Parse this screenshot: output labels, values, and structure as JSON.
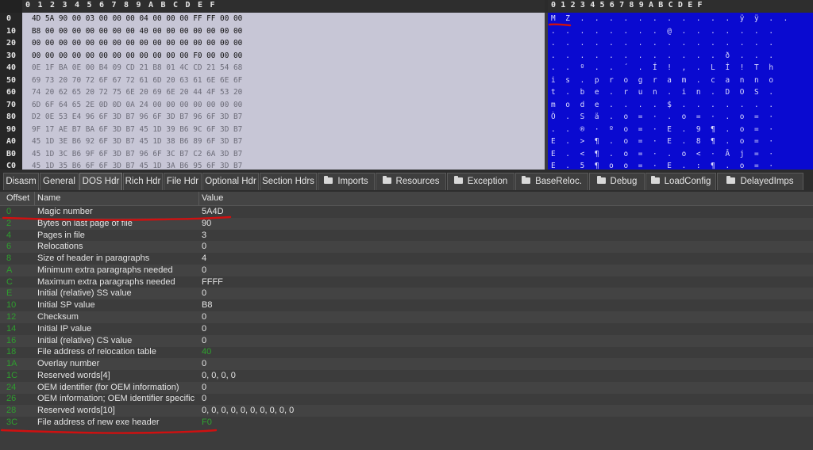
{
  "hex_view": {
    "column_header": [
      "0",
      "1",
      "2",
      "3",
      "4",
      "5",
      "6",
      "7",
      "8",
      "9",
      "A",
      "B",
      "C",
      "D",
      "E",
      "F"
    ],
    "text_column_header": "0 1 2 3 4 5 6 7 8 9 A B C D E F",
    "rows": [
      {
        "addr": "0",
        "hex": "4D 5A 90 00 03 00 00 00 04 00 00 00 FF FF 00 00",
        "text": "M Z . . . . . . . . . . . ÿ ÿ . ."
      },
      {
        "addr": "10",
        "hex": "B8 00 00 00 00 00 00 00 40 00 00 00 00 00 00 00",
        "text": ". . . . . . . . @ . . . . . . ."
      },
      {
        "addr": "20",
        "hex": "00 00 00 00 00 00 00 00 00 00 00 00 00 00 00 00",
        "text": ". . . . . . . . . . . . . . . ."
      },
      {
        "addr": "30",
        "hex": "00 00 00 00 00 00 00 00 00 00 00 00 F0 00 00 00",
        "text": ". . . . . . . . . . . . ð . . ."
      },
      {
        "addr": "40",
        "hex": "0E 1F BA 0E 00 B4 09 CD 21 B8 01 4C CD 21 54 68",
        "text": ". . º . . ´ . Í ! , . L Í ! T h"
      },
      {
        "addr": "50",
        "hex": "69 73 20 70 72 6F 67 72 61 6D 20 63 61 6E 6E 6F",
        "text": "i s . p r o g r a m . c a n n o"
      },
      {
        "addr": "60",
        "hex": "74 20 62 65 20 72 75 6E 20 69 6E 20 44 4F 53 20",
        "text": "t . b e . r u n . i n . D O S ."
      },
      {
        "addr": "70",
        "hex": "6D 6F 64 65 2E 0D 0D 0A 24 00 00 00 00 00 00 00",
        "text": "m o d e . . . . $ . . . . . . ."
      },
      {
        "addr": "80",
        "hex": "D2 0E 53 E4 96 6F 3D B7 96 6F 3D B7 96 6F 3D B7",
        "text": "Ò . S ä . o = · . o = · . o = ·"
      },
      {
        "addr": "90",
        "hex": "9F 17 AE B7 BA 6F 3D B7 45 1D 39 B6 9C 6F 3D B7",
        "text": ". . ® · º o = · E . 9 ¶ . o = ·"
      },
      {
        "addr": "A0",
        "hex": "45 1D 3E B6 92 6F 3D B7 45 1D 38 B6 89 6F 3D B7",
        "text": "E . > ¶ . o = · E . 8 ¶ . o = ·"
      },
      {
        "addr": "B0",
        "hex": "45 1D 3C B6 9F 6F 3D B7 96 6F 3C B7 C2 6A 3D B7",
        "text": "E . < ¶ . o = · . o < · Â j = ·"
      },
      {
        "addr": "C0",
        "hex": "45 1D 35 B6 6F 6F 3D B7 45 1D 3A B6 95 6F 3D B7",
        "text": "E . 5 ¶ o o = · E . : ¶ . o = ·"
      }
    ]
  },
  "tabs": [
    {
      "label": "Disasm",
      "icon": ""
    },
    {
      "label": "General",
      "icon": ""
    },
    {
      "label": "DOS Hdr",
      "icon": "",
      "active": true
    },
    {
      "label": "Rich Hdr",
      "icon": ""
    },
    {
      "label": "File Hdr",
      "icon": ""
    },
    {
      "label": "Optional Hdr",
      "icon": ""
    },
    {
      "label": "Section Hdrs",
      "icon": ""
    },
    {
      "label": "Imports",
      "icon": "folder-icon"
    },
    {
      "label": "Resources",
      "icon": "folder-icon"
    },
    {
      "label": "Exception",
      "icon": "folder-icon"
    },
    {
      "label": "BaseReloc.",
      "icon": "folder-icon"
    },
    {
      "label": "Debug",
      "icon": "folder-icon"
    },
    {
      "label": "LoadConfig",
      "icon": "folder-icon"
    },
    {
      "label": "DelayedImps",
      "icon": "folder-icon"
    }
  ],
  "table": {
    "columns": {
      "offset": "Offset",
      "name": "Name",
      "value": "Value"
    },
    "rows": [
      {
        "offset": "0",
        "name": "Magic number",
        "value": "5A4D"
      },
      {
        "offset": "2",
        "name": "Bytes on last page of file",
        "value": "90"
      },
      {
        "offset": "4",
        "name": "Pages in file",
        "value": "3"
      },
      {
        "offset": "6",
        "name": "Relocations",
        "value": "0"
      },
      {
        "offset": "8",
        "name": "Size of header in paragraphs",
        "value": "4"
      },
      {
        "offset": "A",
        "name": "Minimum extra paragraphs needed",
        "value": "0"
      },
      {
        "offset": "C",
        "name": "Maximum extra paragraphs needed",
        "value": "FFFF"
      },
      {
        "offset": "E",
        "name": "Initial (relative) SS value",
        "value": "0"
      },
      {
        "offset": "10",
        "name": "Initial SP value",
        "value": "B8"
      },
      {
        "offset": "12",
        "name": "Checksum",
        "value": "0"
      },
      {
        "offset": "14",
        "name": "Initial IP value",
        "value": "0"
      },
      {
        "offset": "16",
        "name": "Initial (relative) CS value",
        "value": "0"
      },
      {
        "offset": "18",
        "name": "File address of relocation table",
        "value": "40",
        "highlight": true
      },
      {
        "offset": "1A",
        "name": "Overlay number",
        "value": "0"
      },
      {
        "offset": "1C",
        "name": "Reserved words[4]",
        "value": "0, 0, 0, 0"
      },
      {
        "offset": "24",
        "name": "OEM identifier (for OEM information)",
        "value": "0"
      },
      {
        "offset": "26",
        "name": "OEM information; OEM identifier specific",
        "value": "0"
      },
      {
        "offset": "28",
        "name": "Reserved words[10]",
        "value": "0, 0, 0, 0, 0, 0, 0, 0, 0, 0"
      },
      {
        "offset": "3C",
        "name": "File address of new exe header",
        "value": "F0",
        "highlight": true
      }
    ]
  },
  "colors": {
    "hex_bg": "#c7c6d6",
    "text_bg": "#0a0ad0",
    "offset_green": "#2f9e2f",
    "annotation_red": "#d01010"
  }
}
